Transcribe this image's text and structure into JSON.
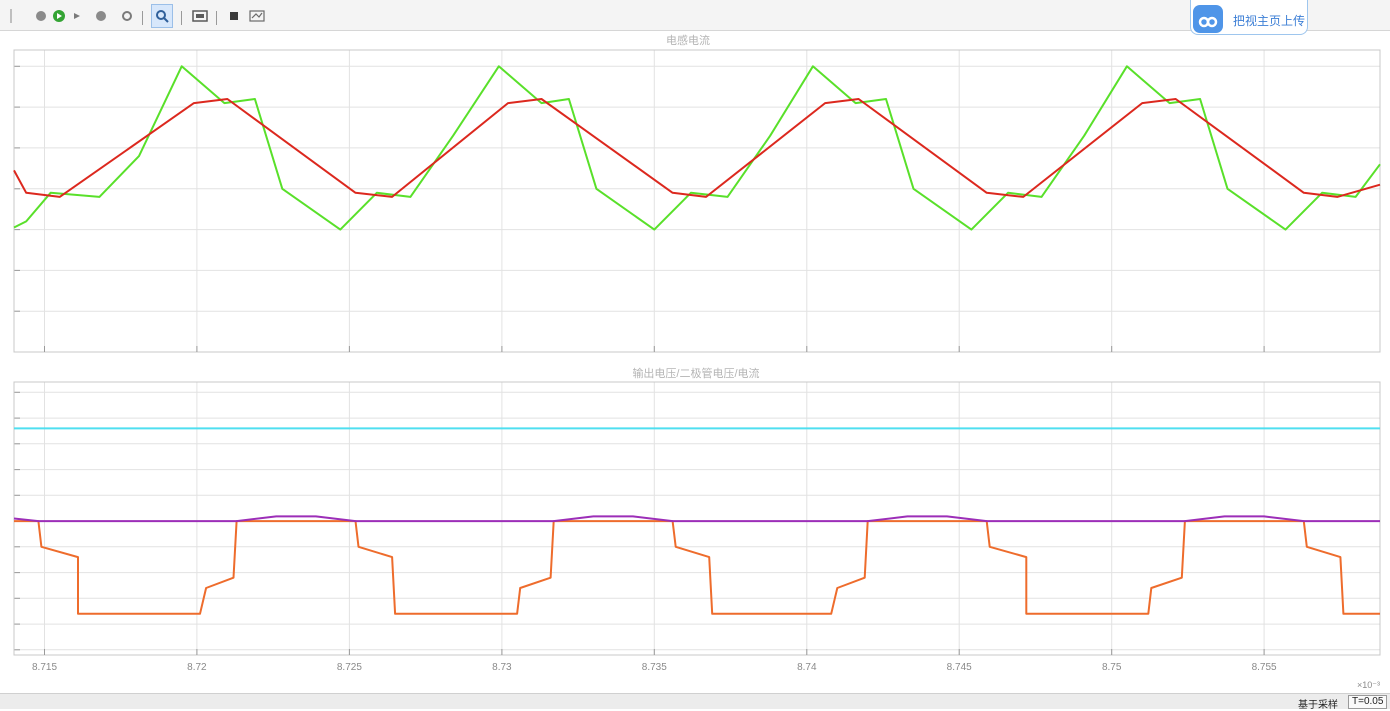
{
  "toolbar": {
    "share_label": "把视主页上传",
    "icons": [
      "run-icon",
      "play-icon",
      "step-forward-icon",
      "stop-icon",
      "settings-icon",
      "zoom-icon",
      "fit-view-icon",
      "layout-icon",
      "legend-icon"
    ]
  },
  "status": {
    "mode_label": "基于采样",
    "time_label": "T=0.05"
  },
  "colors": {
    "background": "#ffffff",
    "grid": "#e2e2e2",
    "axes": "#c8c8c8",
    "title_text": "#b4b4b4",
    "tick_text": "#8a8a8a"
  },
  "chart_data": [
    {
      "type": "line",
      "title": "电感电流",
      "xlim": [
        0.008714,
        0.0087588
      ],
      "x_ticks": [
        0.008715,
        0.00872,
        0.008725,
        0.00873,
        0.008735,
        0.00874,
        0.008745,
        0.00875,
        0.008755
      ],
      "x_tick_labels": [
        "8.715",
        "8.72",
        "8.725",
        "8.73",
        "8.735",
        "8.74",
        "8.745",
        "8.75",
        "8.755"
      ],
      "x_exponent_label": "×10⁻³",
      "ylim": [
        0,
        7.4
      ],
      "y_ticks": [
        1,
        2,
        3,
        4,
        5,
        6,
        7
      ],
      "grid": true,
      "legend": false,
      "series": [
        {
          "color": "#59e02a",
          "points": [
            [
              0.008714,
              3.05
            ],
            [
              0.0087144,
              3.2
            ],
            [
              0.0087152,
              3.9
            ],
            [
              0.0087168,
              3.8
            ],
            [
              0.0087181,
              4.8
            ],
            [
              0.0087195,
              7.0
            ],
            [
              0.0087209,
              6.1
            ],
            [
              0.0087219,
              6.2
            ],
            [
              0.0087228,
              4.0
            ],
            [
              0.0087247,
              3.0
            ],
            [
              0.0087259,
              3.9
            ],
            [
              0.008727,
              3.8
            ],
            [
              0.0087284,
              5.3
            ],
            [
              0.0087299,
              7.0
            ],
            [
              0.0087313,
              6.1
            ],
            [
              0.0087322,
              6.2
            ],
            [
              0.0087331,
              4.0
            ],
            [
              0.008735,
              3.0
            ],
            [
              0.0087362,
              3.9
            ],
            [
              0.0087374,
              3.8
            ],
            [
              0.0087388,
              5.3
            ],
            [
              0.0087402,
              7.0
            ],
            [
              0.0087416,
              6.1
            ],
            [
              0.0087426,
              6.2
            ],
            [
              0.0087435,
              4.0
            ],
            [
              0.0087454,
              3.0
            ],
            [
              0.0087466,
              3.9
            ],
            [
              0.0087477,
              3.8
            ],
            [
              0.0087491,
              5.3
            ],
            [
              0.0087505,
              7.0
            ],
            [
              0.0087519,
              6.1
            ],
            [
              0.0087529,
              6.2
            ],
            [
              0.0087538,
              4.0
            ],
            [
              0.0087557,
              3.0
            ],
            [
              0.0087569,
              3.9
            ],
            [
              0.008758,
              3.8
            ],
            [
              0.0087588,
              4.6
            ]
          ]
        },
        {
          "color": "#dc281e",
          "points": [
            [
              0.008714,
              4.45
            ],
            [
              0.0087144,
              3.9
            ],
            [
              0.0087155,
              3.8
            ],
            [
              0.0087199,
              6.1
            ],
            [
              0.008721,
              6.2
            ],
            [
              0.0087252,
              3.9
            ],
            [
              0.0087264,
              3.8
            ],
            [
              0.0087302,
              6.1
            ],
            [
              0.0087313,
              6.2
            ],
            [
              0.0087356,
              3.9
            ],
            [
              0.0087367,
              3.8
            ],
            [
              0.0087406,
              6.1
            ],
            [
              0.0087417,
              6.2
            ],
            [
              0.0087459,
              3.9
            ],
            [
              0.0087471,
              3.8
            ],
            [
              0.008751,
              6.1
            ],
            [
              0.0087521,
              6.2
            ],
            [
              0.0087563,
              3.9
            ],
            [
              0.0087574,
              3.8
            ],
            [
              0.0087588,
              4.1
            ]
          ]
        }
      ]
    },
    {
      "type": "line",
      "title": "输出电压/二极管电压/电流",
      "xlim": [
        0.008714,
        0.0087588
      ],
      "x_ticks": [
        0.008715,
        0.00872,
        0.008725,
        0.00873,
        0.008735,
        0.00874,
        0.008745,
        0.00875,
        0.008755
      ],
      "x_tick_labels": [
        "8.715",
        "8.72",
        "8.725",
        "8.73",
        "8.735",
        "8.74",
        "8.745",
        "8.75",
        "8.755"
      ],
      "x_exponent_label": "×10⁻³",
      "ylim": [
        -0.2,
        10.4
      ],
      "y_ticks": [
        0,
        1,
        2,
        3,
        4,
        5,
        6,
        7,
        8,
        9,
        10
      ],
      "grid": true,
      "legend": false,
      "series": [
        {
          "color": "#4fdff0",
          "points": [
            [
              0.008714,
              8.6
            ],
            [
              0.0087588,
              8.6
            ]
          ]
        },
        {
          "color": "#ee6c2c",
          "points": [
            [
              0.008714,
              5.0
            ],
            [
              0.0087148,
              5.0
            ],
            [
              0.0087149,
              4.0
            ],
            [
              0.0087161,
              3.6
            ],
            [
              0.0087161,
              1.4
            ],
            [
              0.0087201,
              1.4
            ],
            [
              0.0087203,
              2.4
            ],
            [
              0.0087212,
              2.8
            ],
            [
              0.0087213,
              5.0
            ],
            [
              0.0087252,
              5.0
            ],
            [
              0.0087253,
              4.0
            ],
            [
              0.0087264,
              3.6
            ],
            [
              0.0087265,
              1.4
            ],
            [
              0.0087305,
              1.4
            ],
            [
              0.0087306,
              2.4
            ],
            [
              0.0087316,
              2.8
            ],
            [
              0.0087317,
              5.0
            ],
            [
              0.0087356,
              5.0
            ],
            [
              0.0087357,
              4.0
            ],
            [
              0.0087368,
              3.6
            ],
            [
              0.0087369,
              1.4
            ],
            [
              0.0087408,
              1.4
            ],
            [
              0.008741,
              2.4
            ],
            [
              0.0087419,
              2.8
            ],
            [
              0.008742,
              5.0
            ],
            [
              0.0087459,
              5.0
            ],
            [
              0.008746,
              4.0
            ],
            [
              0.0087472,
              3.6
            ],
            [
              0.0087472,
              1.4
            ],
            [
              0.0087512,
              1.4
            ],
            [
              0.0087513,
              2.4
            ],
            [
              0.0087523,
              2.8
            ],
            [
              0.0087524,
              5.0
            ],
            [
              0.0087563,
              5.0
            ],
            [
              0.0087564,
              4.0
            ],
            [
              0.0087575,
              3.6
            ],
            [
              0.0087576,
              1.4
            ],
            [
              0.0087588,
              1.4
            ]
          ]
        },
        {
          "color": "#9c2eb8",
          "points": [
            [
              0.008714,
              5.1
            ],
            [
              0.0087148,
              5.0
            ],
            [
              0.0087213,
              5.0
            ],
            [
              0.0087226,
              5.18
            ],
            [
              0.0087239,
              5.18
            ],
            [
              0.0087252,
              5.0
            ],
            [
              0.0087317,
              5.0
            ],
            [
              0.008733,
              5.18
            ],
            [
              0.0087343,
              5.18
            ],
            [
              0.0087356,
              5.0
            ],
            [
              0.008742,
              5.0
            ],
            [
              0.0087433,
              5.18
            ],
            [
              0.0087446,
              5.18
            ],
            [
              0.0087459,
              5.0
            ],
            [
              0.0087524,
              5.0
            ],
            [
              0.0087537,
              5.18
            ],
            [
              0.008755,
              5.18
            ],
            [
              0.0087563,
              5.0
            ],
            [
              0.0087588,
              5.0
            ]
          ]
        }
      ]
    }
  ]
}
